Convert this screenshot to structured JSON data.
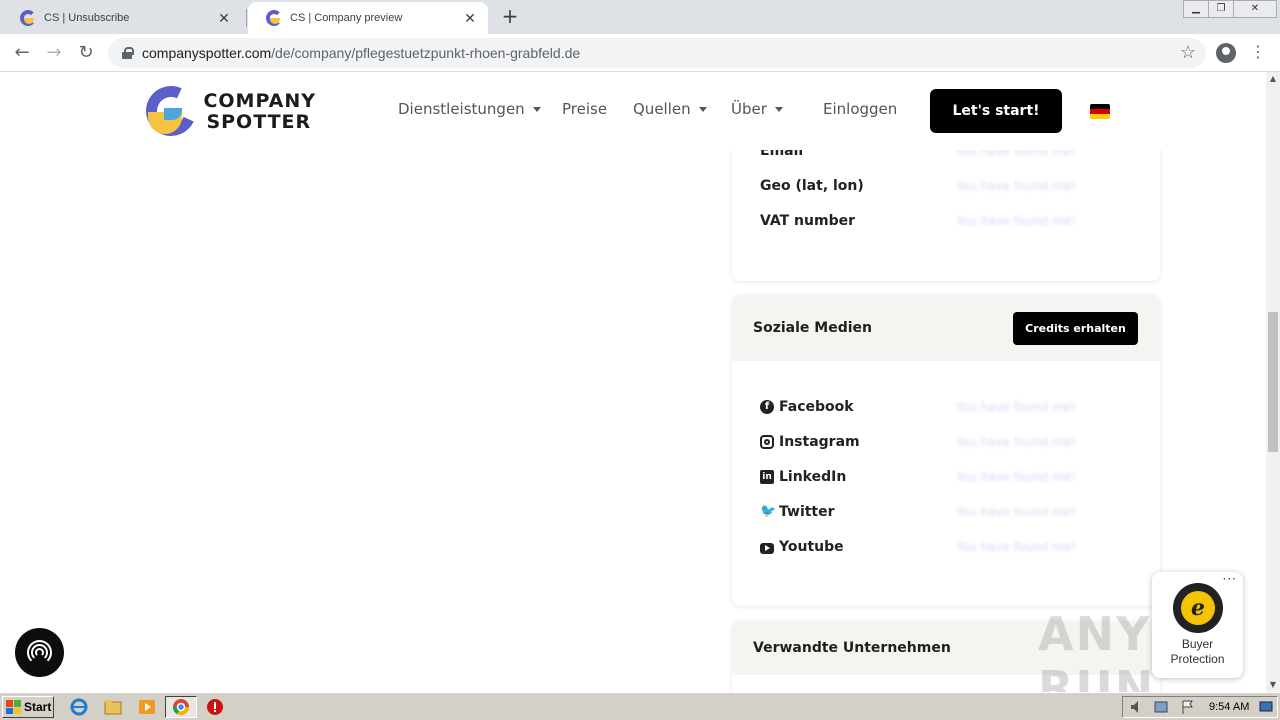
{
  "browser": {
    "tabs": [
      {
        "title": "CS | Unsubscribe",
        "close": "✕"
      },
      {
        "title": "CS | Company preview",
        "close": "✕"
      }
    ],
    "new_tab": "+",
    "url_host": "companyspotter.com",
    "url_path": "/de/company/pflegestuetzpunkt-rhoen-grabfeld.de"
  },
  "site": {
    "logo_line1": "COMPANY",
    "logo_line2": "SPOTTER",
    "nav": {
      "services": "Dienstleistungen",
      "prices": "Preise",
      "sources": "Quellen",
      "about": "Über",
      "login": "Einloggen"
    },
    "cta": "Let's start!",
    "colors": {
      "brand_purple": "#5b5fc7",
      "brand_yellow": "#f6c343",
      "brand_blue": "#4ea6df"
    }
  },
  "contact_card": {
    "rows": [
      {
        "label": "Email",
        "value": "You have found me!"
      },
      {
        "label": "Geo (lat, lon)",
        "value": "You have found me!"
      },
      {
        "label": "VAT number",
        "value": "You have found me!"
      }
    ]
  },
  "social_card": {
    "title": "Soziale Medien",
    "button": "Credits erhalten",
    "rows": [
      {
        "label": "Facebook",
        "icon": "facebook-icon",
        "value": "You have found me!"
      },
      {
        "label": "Instagram",
        "icon": "instagram-icon",
        "value": "You have found me!"
      },
      {
        "label": "LinkedIn",
        "icon": "linkedin-icon",
        "value": "You have found me!"
      },
      {
        "label": "Twitter",
        "icon": "twitter-icon",
        "value": "You have found me!"
      },
      {
        "label": "Youtube",
        "icon": "youtube-icon",
        "value": "You have found me!"
      }
    ]
  },
  "related_card": {
    "title": "Verwandte Unternehmen"
  },
  "trusted_shops": {
    "line1": "Buyer",
    "line2": "Protection",
    "seal_letter": "e"
  },
  "watermark": "ANY RUN",
  "taskbar": {
    "start": "Start",
    "clock": "9:54 AM"
  }
}
